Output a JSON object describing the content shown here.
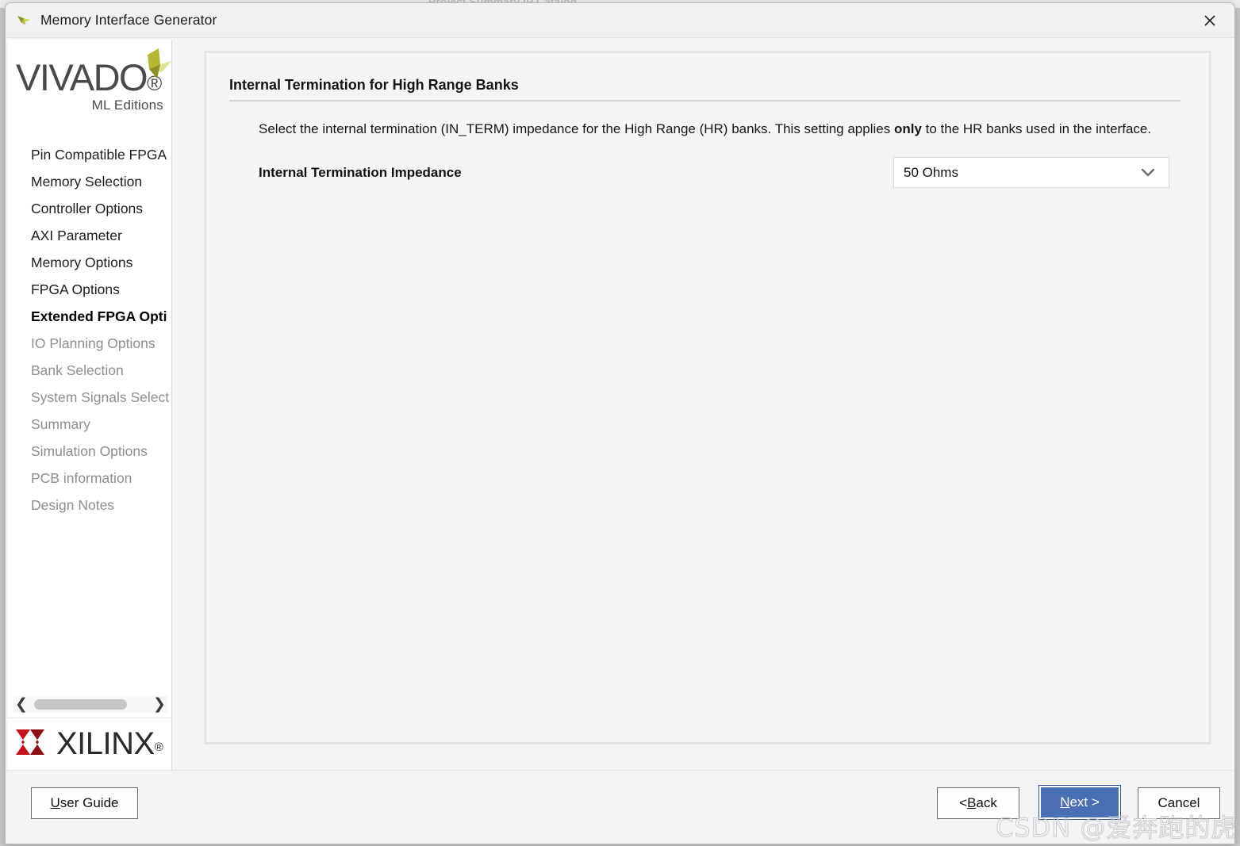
{
  "background_window": {
    "ghost_text": "Project Summary          IP Catalog"
  },
  "window": {
    "title": "Memory Interface Generator",
    "app_icon": "vivado-logo-icon",
    "close_icon": "close-icon"
  },
  "sidebar": {
    "logo": {
      "wordmark": "VIVADO",
      "registered_mark": "®",
      "subtitle": "ML Editions",
      "mark_icon": "vivado-chevron-icon"
    },
    "items": [
      {
        "label": "Pin Compatible FPGA",
        "state": "enabled"
      },
      {
        "label": "Memory Selection",
        "state": "enabled"
      },
      {
        "label": "Controller Options",
        "state": "enabled"
      },
      {
        "label": "AXI Parameter",
        "state": "enabled"
      },
      {
        "label": "Memory Options",
        "state": "enabled"
      },
      {
        "label": "FPGA Options",
        "state": "enabled"
      },
      {
        "label": "Extended FPGA Opti",
        "state": "current"
      },
      {
        "label": "IO Planning Options",
        "state": "disabled"
      },
      {
        "label": "Bank Selection",
        "state": "disabled"
      },
      {
        "label": "System Signals Select",
        "state": "disabled"
      },
      {
        "label": "Summary",
        "state": "disabled"
      },
      {
        "label": "Simulation Options",
        "state": "disabled"
      },
      {
        "label": "PCB information",
        "state": "disabled"
      },
      {
        "label": "Design Notes",
        "state": "disabled"
      }
    ],
    "scrollbar": {
      "left_arrow_icon": "chevron-left-icon",
      "right_arrow_icon": "chevron-right-icon"
    },
    "footer_logo": {
      "wordmark": "XILINX",
      "registered_mark": "®",
      "mark_icon": "xilinx-x-icon"
    }
  },
  "content": {
    "section_title": "Internal Termination for High Range Banks",
    "description_part1": "Select the internal termination (IN_TERM) impedance for the High Range (HR) banks. This setting applies ",
    "description_emphasis": "only",
    "description_part2": " to the HR banks used in the interface.",
    "field": {
      "label": "Internal Termination Impedance",
      "value": "50 Ohms",
      "chevron_icon": "chevron-down-icon"
    }
  },
  "footer": {
    "user_guide": {
      "prefix": "",
      "accel": "U",
      "suffix": "ser Guide"
    },
    "back": {
      "prefix": "< ",
      "accel": "B",
      "suffix": "ack"
    },
    "next": {
      "prefix": "",
      "accel": "N",
      "suffix": "ext >"
    },
    "cancel": {
      "prefix": "Cancel",
      "accel": "",
      "suffix": ""
    }
  },
  "watermark": {
    "text": "CSDN @爱奔跑的虎子"
  },
  "colors": {
    "accent_button": "#4a6fb5",
    "vivado_mark": "#c9cf4a",
    "xilinx_mark": "#c5121c",
    "panel_bg": "#f5f5f6",
    "sidebar_bg": "#ffffff"
  }
}
